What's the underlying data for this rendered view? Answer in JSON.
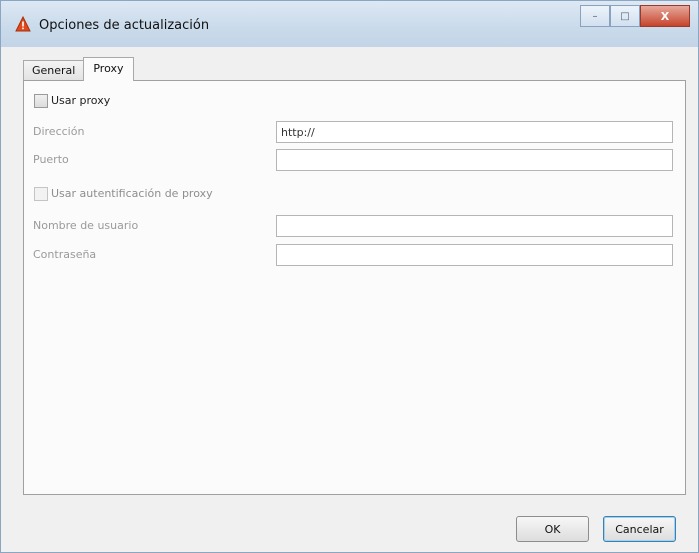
{
  "window": {
    "title": "Opciones de actualización",
    "icon": "warning-triangle-icon",
    "controls": {
      "minimize": "–",
      "maximize": "□",
      "close": "X"
    }
  },
  "tabs": [
    {
      "label": "General",
      "active": false
    },
    {
      "label": "Proxy",
      "active": true
    }
  ],
  "proxy": {
    "use_proxy_label": "Usar proxy",
    "use_proxy_checked": false,
    "address_label": "Dirección",
    "address_value": "http://",
    "port_label": "Puerto",
    "port_value": "",
    "use_auth_label": "Usar autentificación de proxy",
    "use_auth_checked": false,
    "username_label": "Nombre de usuario",
    "username_value": "",
    "password_label": "Contraseña",
    "password_value": ""
  },
  "buttons": {
    "ok": "OK",
    "cancel": "Cancelar"
  },
  "colors": {
    "accent_title": "#c8d9ea",
    "close_button": "#c6442c",
    "warning_icon": "#e04a1a"
  }
}
